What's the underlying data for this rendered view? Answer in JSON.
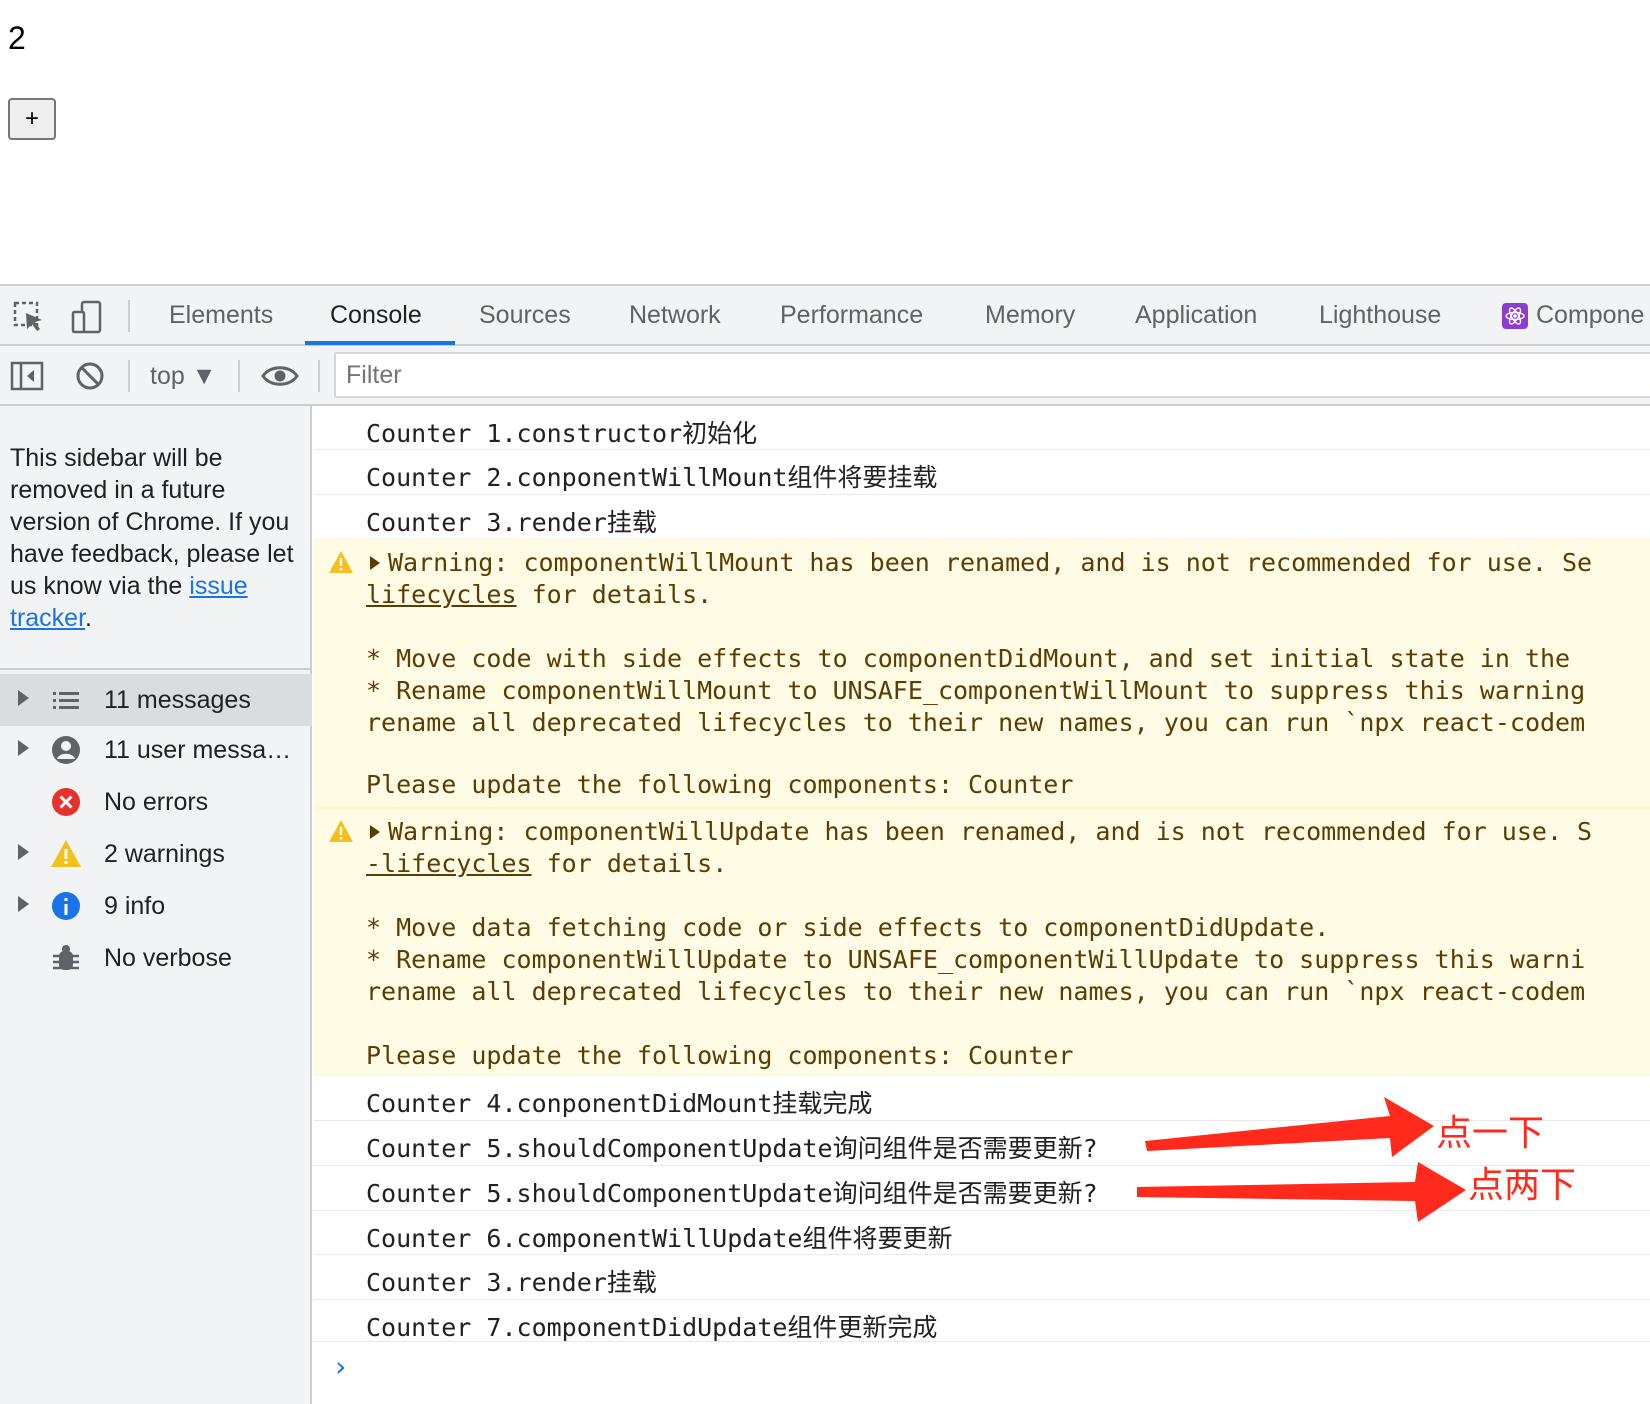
{
  "page": {
    "count": "2",
    "increment_label": "+"
  },
  "tabs": [
    {
      "label": "Elements"
    },
    {
      "label": "Console"
    },
    {
      "label": "Sources"
    },
    {
      "label": "Network"
    },
    {
      "label": "Performance"
    },
    {
      "label": "Memory"
    },
    {
      "label": "Application"
    },
    {
      "label": "Lighthouse"
    },
    {
      "label": "Compone"
    }
  ],
  "active_tab": "Console",
  "toolbar": {
    "context": "top ▼",
    "filter_placeholder": "Filter"
  },
  "sidebar": {
    "notice_text": "This sidebar will be removed in a future version of Chrome. If you have feedback, please let us know via the ",
    "notice_link": "issue tracker",
    "notice_end": ".",
    "items": [
      {
        "label": "11 messages",
        "icon": "list-icon"
      },
      {
        "label": "11 user messa…",
        "icon": "user-icon"
      },
      {
        "label": "No errors",
        "icon": "error-icon"
      },
      {
        "label": "2 warnings",
        "icon": "warning-icon"
      },
      {
        "label": "9 info",
        "icon": "info-icon"
      },
      {
        "label": "No verbose",
        "icon": "bug-icon"
      }
    ]
  },
  "console": {
    "logs_before": [
      "Counter 1.constructor初始化",
      "Counter 2.conponentWillMount组件将要挂载",
      "Counter 3.render挂载"
    ],
    "warning1": {
      "line1": "Warning: componentWillMount has been renamed, and is not recommended for use. Se",
      "link": "lifecycles",
      "line2_rest": " for details.",
      "line3": "* Move code with side effects to componentDidMount, and set initial state in the",
      "line4": "* Rename componentWillMount to UNSAFE_componentWillMount to suppress this warning",
      "line5": "rename all deprecated lifecycles to their new names, you can run `npx react-codem",
      "line6": "Please update the following components: Counter"
    },
    "warning2": {
      "line1": "Warning: componentWillUpdate has been renamed, and is not recommended for use. S",
      "link": "-lifecycles",
      "line2_rest": " for details.",
      "line3": "* Move data fetching code or side effects to componentDidUpdate.",
      "line4": "* Rename componentWillUpdate to UNSAFE_componentWillUpdate to suppress this warni",
      "line5": "rename all deprecated lifecycles to their new names, you can run `npx react-codem",
      "line6": "Please update the following components: Counter"
    },
    "logs_after": [
      "Counter 4.conponentDidMount挂载完成",
      "Counter 5.shouldComponentUpdate询问组件是否需要更新?",
      "Counter 5.shouldComponentUpdate询问组件是否需要更新?",
      "Counter 6.componentWillUpdate组件将要更新",
      "Counter 3.render挂载",
      "Counter 7.componentDidUpdate组件更新完成"
    ],
    "prompt": "›"
  },
  "annotations": {
    "click_once": "点一下",
    "click_twice": "点两下",
    "color": "#ff2a1c"
  }
}
